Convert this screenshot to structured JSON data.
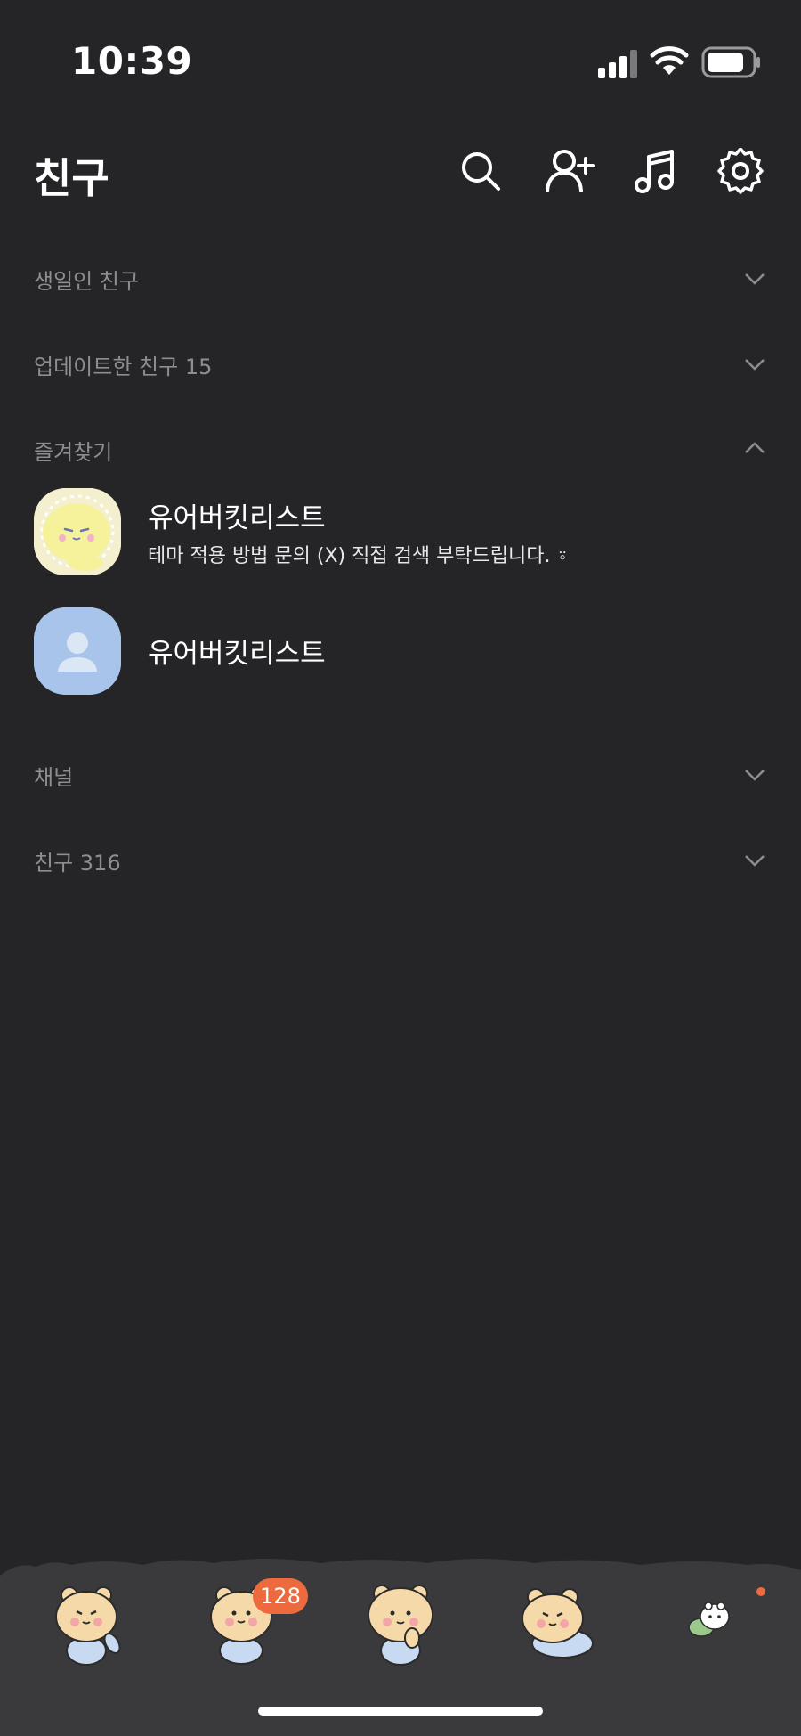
{
  "status_bar": {
    "time": "10:39"
  },
  "header": {
    "title": "친구"
  },
  "sections": {
    "birthday": "생일인 친구",
    "updated": "업데이트한 친구 15",
    "favorites": "즐겨찾기",
    "channel": "채널",
    "friends": "친구 316"
  },
  "favorites": [
    {
      "name": "유어버킷리스트",
      "status": "테마 적용 방법 문의 (X) 직접 검색 부탁드립니다. ⍤"
    },
    {
      "name": "유어버킷리스트"
    }
  ],
  "tab_bar": {
    "chat_badge": "128"
  },
  "colors": {
    "background": "#252527",
    "tabbar": "#3a3a3c",
    "badge": "#ec6a3d",
    "default_avatar": "#a9c4ea"
  }
}
